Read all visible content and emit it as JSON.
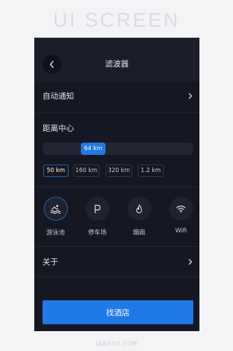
{
  "banner": "UI SCREEN",
  "header": {
    "title": "滤波器"
  },
  "auto_notify": {
    "label": "自动通知"
  },
  "distance": {
    "label": "距离中心",
    "slider_value": "64 km",
    "options": [
      "50 km",
      "160 km",
      "320 km",
      "1.2 km"
    ],
    "selected_index": 0
  },
  "amenities": [
    {
      "label": "游泳池",
      "icon": "swimming-icon",
      "selected": true
    },
    {
      "label": "停车场",
      "icon": "parking-icon",
      "selected": false
    },
    {
      "label": "烟囱",
      "icon": "fire-icon",
      "selected": false
    },
    {
      "label": "Wifi",
      "icon": "wifi-icon",
      "selected": false
    }
  ],
  "about": {
    "label": "关于"
  },
  "search_button": {
    "label": "找酒店"
  },
  "watermark": "IBAOTU.COM",
  "colors": {
    "accent": "#1e7ae6",
    "background": "#151722",
    "header": "#1b1d2b"
  }
}
